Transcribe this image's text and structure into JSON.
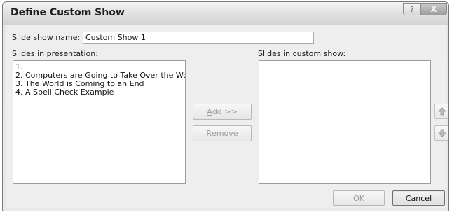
{
  "window": {
    "title": "Define Custom Show",
    "help_glyph": "?",
    "close_glyph": "X"
  },
  "show_name": {
    "label_prefix": "Slide show ",
    "label_accel": "n",
    "label_suffix": "ame:",
    "value": "Custom Show 1"
  },
  "presentation": {
    "label_prefix": "Slides in ",
    "label_accel": "p",
    "label_suffix": "resentation:",
    "items": [
      "1.",
      "2. Computers are Going to Take Over the Wo",
      "3. The World is Coming to an End",
      "4. A Spell Check Example"
    ]
  },
  "custom_show": {
    "label_prefix": "Sl",
    "label_accel": "i",
    "label_suffix": "des in custom show:",
    "items": []
  },
  "buttons": {
    "add_accel": "A",
    "add_rest": "dd >>",
    "remove_accel": "R",
    "remove_rest": "emove",
    "ok": "OK",
    "cancel": "Cancel"
  },
  "icons": {
    "move_up": "move-up-arrow-icon",
    "move_down": "move-down-arrow-icon"
  },
  "colors": {
    "disabled_text": "#9a9a9a",
    "titlebar": "#e3e3e3",
    "client_bg": "#eeeeee"
  }
}
